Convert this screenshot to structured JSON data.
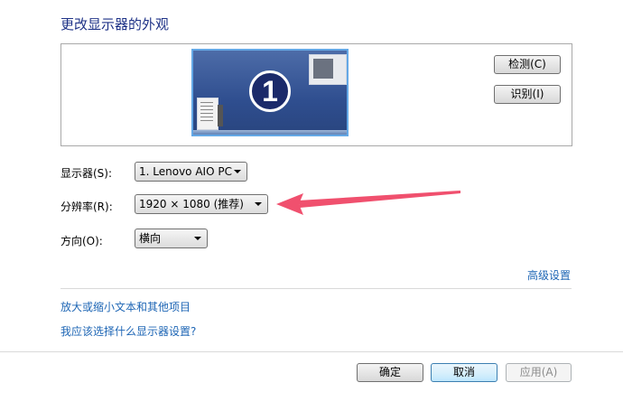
{
  "title": "更改显示器的外观",
  "preview": {
    "monitor_number": "1"
  },
  "buttons": {
    "detect": "检测(C)",
    "identify": "识别(I)",
    "ok": "确定",
    "cancel": "取消",
    "apply": "应用(A)"
  },
  "fields": {
    "display": {
      "label": "显示器(S):",
      "value": "1. Lenovo AIO PC"
    },
    "resolution": {
      "label": "分辨率(R):",
      "value": "1920 × 1080 (推荐)"
    },
    "orientation": {
      "label": "方向(O):",
      "value": "横向"
    }
  },
  "links": {
    "advanced": "高级设置",
    "text_size": "放大或缩小文本和其他项目",
    "which_settings": "我应该选择什么显示器设置?"
  },
  "colors": {
    "annotation_arrow": "#f0506e",
    "link": "#1e66b5",
    "title": "#1e3287"
  }
}
